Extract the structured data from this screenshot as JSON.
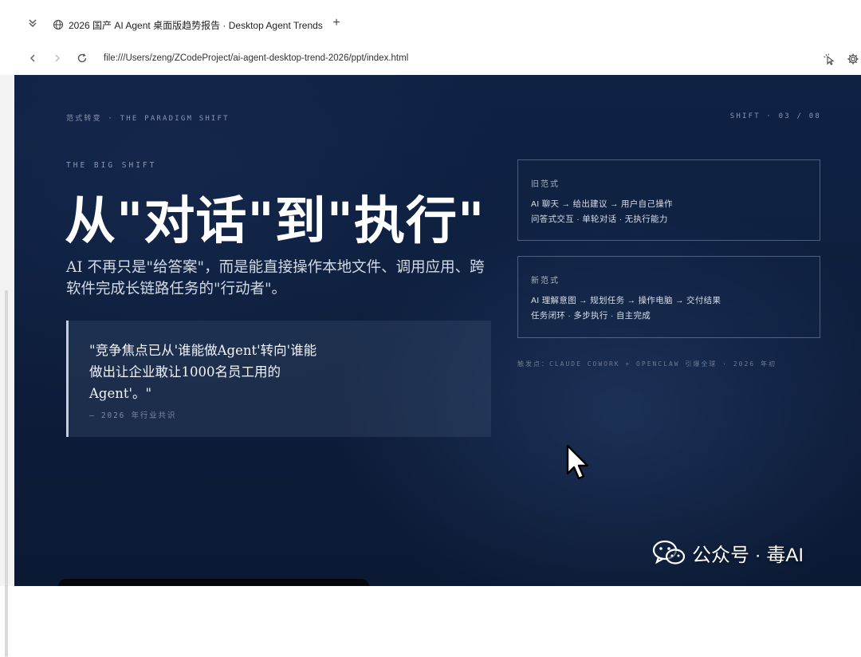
{
  "browser": {
    "tab_title": "2026 国产 AI Agent 桌面版趋势报告 · Desktop Agent Trends",
    "new_tab_label": "+",
    "url": "file:///Users/zeng/ZCodeProject/ai-agent-desktop-trend-2026/ppt/index.html",
    "icons": {
      "collapse": "chevron-double-down-icon",
      "site": "globe-icon",
      "back": "arrow-left-icon",
      "forward": "arrow-right-icon",
      "reload": "reload-icon",
      "extension_1": "cursor-sparkle-icon",
      "extension_2": "gear-icon"
    }
  },
  "slide": {
    "section_label": "范式转变 · THE PARADIGM SHIFT",
    "page_indicator": "SHIFT · 03 / 08",
    "eyebrow": "THE BIG SHIFT",
    "headline": "从\"对话\"到\"执行\"",
    "subtitle": "AI 不再只是\"给答案\"，而是能直接操作本地文件、调用应用、跨软件完成长链路任务的\"行动者\"。",
    "quote": {
      "text": "\"竞争焦点已从'谁能做Agent'转向'谁能做出让企业敢让1000名员工用的Agent'。\"",
      "source": "— 2026 年行业共识"
    },
    "old_paradigm": {
      "label": "旧范式",
      "line1": "AI 聊天 → 给出建议 → 用户自己操作",
      "line2": "问答式交互 · 单轮对话 · 无执行能力"
    },
    "new_paradigm": {
      "label": "新范式",
      "line1": "AI 理解意图 → 规划任务 → 操作电脑 → 交付结果",
      "line2": "任务闭环 · 多步执行 · 自主完成"
    },
    "trigger_note": "触发点：CLAUDE COWORK + OPENCLAW 引爆全球 · 2026 年初"
  },
  "watermark": {
    "text": "公众号 · 毒AI",
    "icon": "wechat-icon"
  },
  "colors": {
    "slide_background": "#0d1d3b",
    "headline": "#ffffff",
    "muted_label": "#8a97ad",
    "card_border": "#96aac8",
    "quote_bar": "#c8ced8"
  }
}
